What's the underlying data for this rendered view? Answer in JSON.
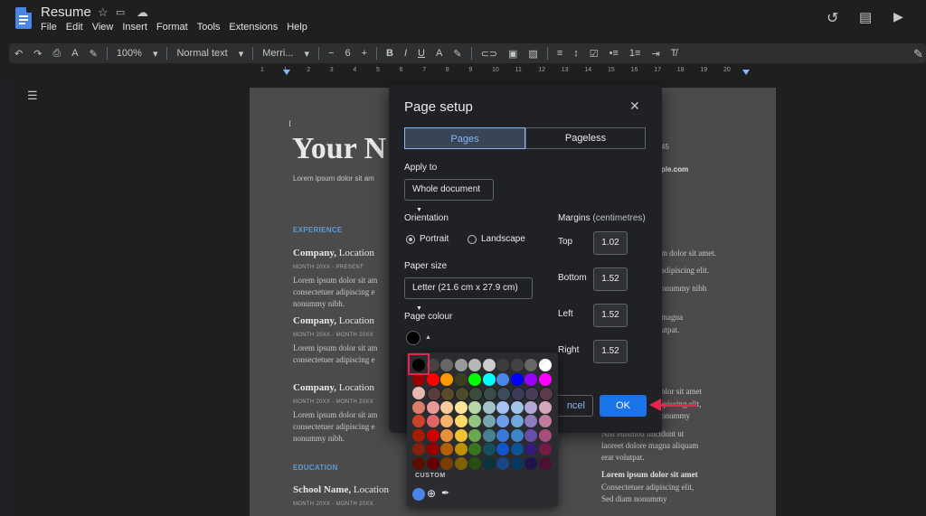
{
  "app": {
    "title": "Resume",
    "menu": [
      "File",
      "Edit",
      "View",
      "Insert",
      "Format",
      "Tools",
      "Extensions",
      "Help"
    ]
  },
  "toolbar": {
    "zoom": "100%",
    "style": "Normal text",
    "font": "Merri...",
    "font_size": "6"
  },
  "ruler": [
    "1",
    "1",
    "2",
    "3",
    "4",
    "5",
    "6",
    "7",
    "8",
    "9",
    "10",
    "11",
    "12",
    "13",
    "14",
    "15",
    "16",
    "17",
    "18",
    "19",
    "20"
  ],
  "document": {
    "name_heading": "Your N",
    "lorem_intro": "Lorem ipsum dolor sit am",
    "phone_fragment": "45",
    "email_fragment": "ple.com",
    "experience_label": "EXPERIENCE",
    "education_label": "EDUCATION",
    "jobs": [
      {
        "company": "Company,",
        "location": " Location",
        "date": "MONTH 20XX - PRESENT",
        "text": [
          "Lorem ipsum dolor sit am",
          "consectetuer adipiscing e",
          "nonummy nibh."
        ]
      },
      {
        "company": "Company,",
        "location": " Location",
        "date": "MONTH 20XX - MONTH 20XX",
        "text": [
          "Lorem ipsum dolor sit am",
          "consectetuer adipiscing e"
        ]
      },
      {
        "company": "Company,",
        "location": " Location",
        "date": "MONTH 20XX - MONTH 20XX",
        "text": [
          "Lorem ipsum dolor sit am",
          "consectetuer adipiscing e",
          "nonummy nibh."
        ]
      }
    ],
    "school": {
      "name": "School Name,",
      "location": " Location",
      "date": "MONTH 20XX - MONTH 20XX"
    },
    "right_col": [
      "m dolor sit amet.",
      "adipiscing elit.",
      "onummy nibh",
      "magna",
      "utpat.",
      "olor sit amet",
      "ipiscing elit,",
      "onummy",
      "Nisl euismod tincidunt ut",
      "laoreet dolore magna aliquam",
      "erat volutpat.",
      "Lorem ipsum dolor sit amet",
      "Consectetuer adipiscing elit,",
      "Sed diam nonummy"
    ]
  },
  "dialog": {
    "title": "Page setup",
    "close": "✕",
    "tabs": [
      "Pages",
      "Pageless"
    ],
    "apply_to_label": "Apply to",
    "apply_to_value": "Whole document",
    "orientation_label": "Orientation",
    "orientation_options": [
      "Portrait",
      "Landscape"
    ],
    "orientation_selected": "Portrait",
    "paper_size_label": "Paper size",
    "paper_size_value": "Letter (21.6 cm x 27.9 cm)",
    "page_colour_label": "Page colour",
    "margins_label": "Margins",
    "margins_unit": "(centimetres)",
    "margins": [
      {
        "label": "Top",
        "value": "1.02"
      },
      {
        "label": "Bottom",
        "value": "1.52"
      },
      {
        "label": "Left",
        "value": "1.52"
      },
      {
        "label": "Right",
        "value": "1.52"
      }
    ],
    "cancel_label": "ncel",
    "ok_label": "OK"
  },
  "palette": {
    "custom_label": "CUSTOM",
    "rows": [
      [
        "#000000",
        "#434343",
        "#666666",
        "#999999",
        "#b7b7b7",
        "#cccccc",
        "#3c3c3c",
        "#434343",
        "#666666",
        "#ffffff"
      ],
      [
        "#980000",
        "#ff0000",
        "#ff9900",
        "#3d3d1f",
        "#00ff00",
        "#00ffff",
        "#4a86e8",
        "#0000ff",
        "#9900ff",
        "#ff00ff"
      ],
      [
        "#e6b8af",
        "#5b3b3b",
        "#5b4b2b",
        "#4b4b2b",
        "#3b4b3b",
        "#3b4b4b",
        "#3b4b5b",
        "#3b3b5b",
        "#4b3b5b",
        "#5b3b4b"
      ],
      [
        "#dd7e6b",
        "#ea9999",
        "#f9cb9c",
        "#ffe599",
        "#b6d7a8",
        "#a2c4c9",
        "#a4c2f4",
        "#9fc5e8",
        "#b4a7d6",
        "#d5a6bd"
      ],
      [
        "#cc4125",
        "#e06666",
        "#f6b26b",
        "#ffd966",
        "#93c47d",
        "#76a5af",
        "#6d9eeb",
        "#6fa8dc",
        "#8e7cc3",
        "#c27ba0"
      ],
      [
        "#a61c00",
        "#cc0000",
        "#e69138",
        "#f1c232",
        "#6aa84f",
        "#45818e",
        "#3c78d8",
        "#3d85c6",
        "#674ea7",
        "#a64d79"
      ],
      [
        "#85200c",
        "#990000",
        "#b45f06",
        "#bf9000",
        "#38761d",
        "#134f5c",
        "#1155cc",
        "#0b5394",
        "#351c75",
        "#741b47"
      ],
      [
        "#5b0f00",
        "#660000",
        "#783f04",
        "#7f6000",
        "#274e13",
        "#0c343d",
        "#1c4587",
        "#073763",
        "#20124d",
        "#4c1130"
      ]
    ]
  }
}
